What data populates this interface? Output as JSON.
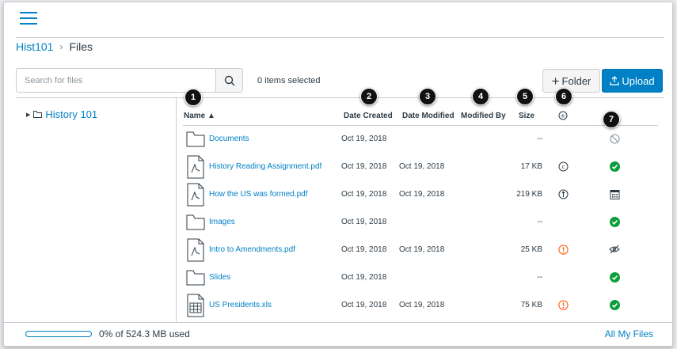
{
  "breadcrumb": {
    "course": "Hist101",
    "separator": ">",
    "current": "Files"
  },
  "search": {
    "placeholder": "Search for files"
  },
  "selection": {
    "count_text": "0 items selected"
  },
  "actions": {
    "folder_label": "Folder",
    "upload_label": "Upload"
  },
  "tree": {
    "root": "History 101"
  },
  "table": {
    "headers": {
      "name": "Name ▲",
      "date_created": "Date Created",
      "date_modified": "Date Modified",
      "modified_by": "Modified By",
      "size": "Size"
    },
    "rows": [
      {
        "name": "Documents",
        "type": "folder-icon",
        "created": "Oct 19, 2018",
        "modified": "",
        "size": "--",
        "usage": "",
        "publish": "unpublished-icon"
      },
      {
        "name": "History Reading Assignment.pdf",
        "type": "pdf-file-icon",
        "created": "Oct 19, 2018",
        "modified": "Oct 19, 2018",
        "size": "17 KB",
        "usage": "copyright-icon",
        "publish": "published-check-icon"
      },
      {
        "name": "How the US was formed.pdf",
        "type": "pdf-file-icon",
        "created": "Oct 19, 2018",
        "modified": "Oct 19, 2018",
        "size": "219 KB",
        "usage": "public-domain-icon",
        "publish": "calendar-restricted-icon"
      },
      {
        "name": "Images",
        "type": "folder-icon",
        "created": "Oct 19, 2018",
        "modified": "",
        "size": "--",
        "usage": "",
        "publish": "published-check-icon"
      },
      {
        "name": "Intro to Amendments.pdf",
        "type": "pdf-file-icon",
        "created": "Oct 19, 2018",
        "modified": "Oct 19, 2018",
        "size": "25 KB",
        "usage": "usage-rights-warning-icon",
        "publish": "hidden-eye-icon"
      },
      {
        "name": "Slides",
        "type": "folder-icon",
        "created": "Oct 19, 2018",
        "modified": "",
        "size": "--",
        "usage": "",
        "publish": "published-check-icon"
      },
      {
        "name": "US Presidents.xls",
        "type": "spreadsheet-file-icon",
        "created": "Oct 19, 2018",
        "modified": "Oct 19, 2018",
        "size": "75 KB",
        "usage": "usage-rights-warning-icon",
        "publish": "published-check-icon"
      }
    ]
  },
  "callouts": [
    "1",
    "2",
    "3",
    "4",
    "5",
    "6",
    "7"
  ],
  "footer": {
    "quota_text": "0% of 524.3 MB used",
    "quota_percent": 0,
    "all_files_link": "All My Files"
  },
  "colors": {
    "accent": "#0081c6",
    "success": "#0b9e3a",
    "warning": "#fc5e13"
  }
}
